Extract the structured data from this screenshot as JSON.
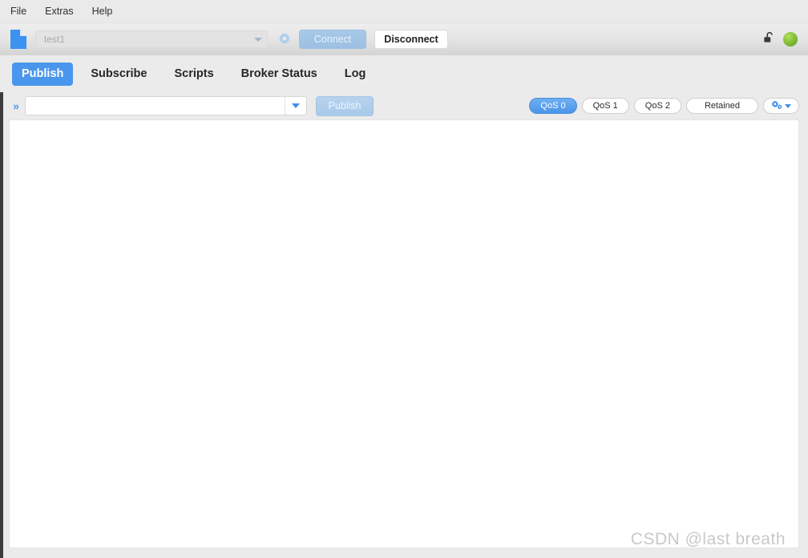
{
  "menubar": {
    "items": [
      {
        "label": "File"
      },
      {
        "label": "Extras"
      },
      {
        "label": "Help"
      }
    ]
  },
  "toolbar": {
    "profile_icon": "document-icon",
    "connection": {
      "value": "test1",
      "placeholder": "test1",
      "dropdown_icon": "chevron-down-icon"
    },
    "settings_icon": "gear-icon",
    "connect_label": "Connect",
    "disconnect_label": "Disconnect",
    "lock_icon": "unlocked-padlock-icon",
    "status_icon": "status-indicator-green",
    "status_color": "#7cb82f"
  },
  "tabs": [
    {
      "label": "Publish",
      "active": true
    },
    {
      "label": "Subscribe",
      "active": false
    },
    {
      "label": "Scripts",
      "active": false
    },
    {
      "label": "Broker Status",
      "active": false
    },
    {
      "label": "Log",
      "active": false
    }
  ],
  "publish_bar": {
    "expander_icon": "double-chevron-right-icon",
    "topic": {
      "value": "",
      "placeholder": "",
      "dropdown_icon": "chevron-down-icon"
    },
    "publish_label": "Publish",
    "qos_options": [
      {
        "label": "QoS 0",
        "selected": true
      },
      {
        "label": "QoS 1",
        "selected": false
      },
      {
        "label": "QoS 2",
        "selected": false
      }
    ],
    "retained_label": "Retained",
    "options_icon": "cogs-icon",
    "options_caret_icon": "caret-down-icon"
  },
  "content": {
    "payload_value": "",
    "watermark": "CSDN @last breath"
  },
  "colors": {
    "accent": "#4a96ec",
    "status_green": "#7cb82f",
    "window_bg": "#ebebeb",
    "panel_bg": "#ffffff"
  }
}
